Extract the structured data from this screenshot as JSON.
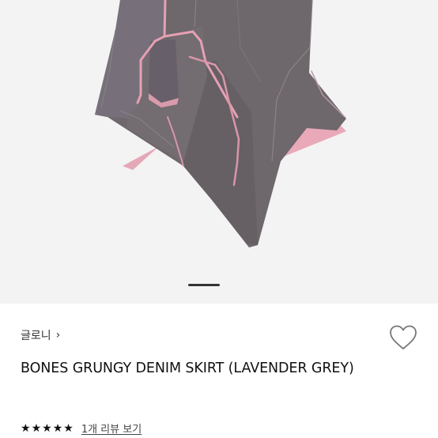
{
  "product": {
    "brand_name": "글로니",
    "title": "BONES GRUNGY DENIM SKIRT (LAVENDER GREY)",
    "rating": {
      "stars_filled": 5,
      "stars_total": 5,
      "review_link_text": "1개 리뷰 보기"
    }
  },
  "gallery": {
    "current_slide_indicator": "active"
  },
  "icons": {
    "brand_chevron": "chevron-right-icon",
    "wishlist": "heart-outline-icon",
    "star": "star-icon"
  },
  "colors": {
    "gallery_background": "#f3f3f3",
    "skirt_fabric": "#6f686c",
    "skirt_lining": "#e9a9b9",
    "pager_active": "#333333",
    "star": "#111111",
    "wish_icon_stroke": "#777777"
  }
}
